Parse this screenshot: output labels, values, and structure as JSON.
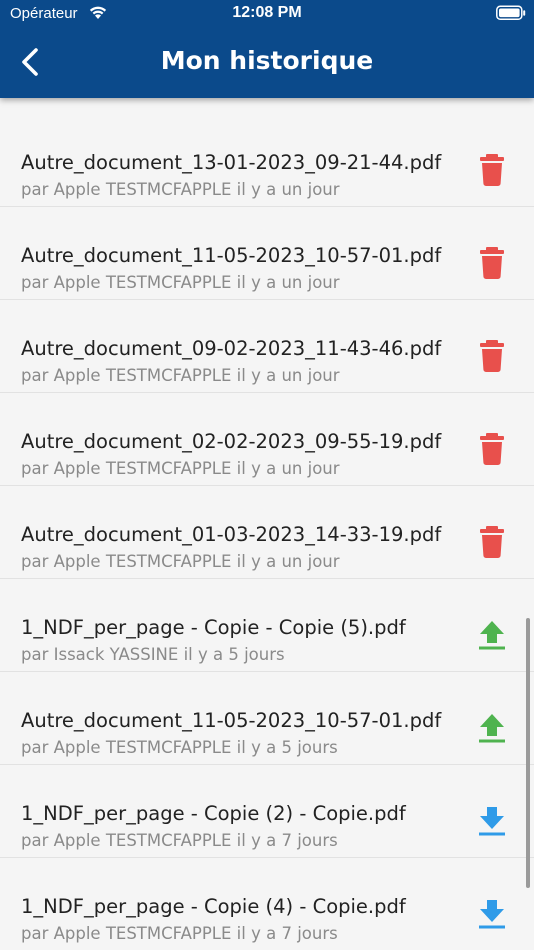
{
  "status_bar": {
    "carrier": "Opérateur",
    "time": "12:08 PM",
    "icons": [
      "wifi-icon",
      "battery-icon"
    ]
  },
  "header": {
    "title": "Mon historique",
    "back_icon": "chevron-left-icon"
  },
  "colors": {
    "header_bg": "#0b4a8b",
    "delete": "#e8504c",
    "upload": "#4fb34f",
    "download": "#2f9be8"
  },
  "history": [
    {
      "file": "Autre_document_13-01-2023_09-21-44.pdf",
      "meta": "par Apple TESTMCFAPPLE il y a un jour",
      "action": "delete"
    },
    {
      "file": "Autre_document_11-05-2023_10-57-01.pdf",
      "meta": "par Apple TESTMCFAPPLE il y a un jour",
      "action": "delete"
    },
    {
      "file": "Autre_document_09-02-2023_11-43-46.pdf",
      "meta": "par Apple TESTMCFAPPLE il y a un jour",
      "action": "delete"
    },
    {
      "file": "Autre_document_02-02-2023_09-55-19.pdf",
      "meta": "par Apple TESTMCFAPPLE il y a un jour",
      "action": "delete"
    },
    {
      "file": "Autre_document_01-03-2023_14-33-19.pdf",
      "meta": "par Apple TESTMCFAPPLE il y a un jour",
      "action": "delete"
    },
    {
      "file": "1_NDF_per_page - Copie - Copie (5).pdf",
      "meta": "par Issack YASSINE il y a 5 jours",
      "action": "upload"
    },
    {
      "file": "Autre_document_11-05-2023_10-57-01.pdf",
      "meta": "par Apple TESTMCFAPPLE il y a 5 jours",
      "action": "upload"
    },
    {
      "file": "1_NDF_per_page - Copie (2) - Copie.pdf",
      "meta": "par Apple TESTMCFAPPLE il y a 7 jours",
      "action": "download"
    },
    {
      "file": "1_NDF_per_page - Copie (4) - Copie.pdf",
      "meta": "par Apple TESTMCFAPPLE il y a 7 jours",
      "action": "download"
    }
  ]
}
